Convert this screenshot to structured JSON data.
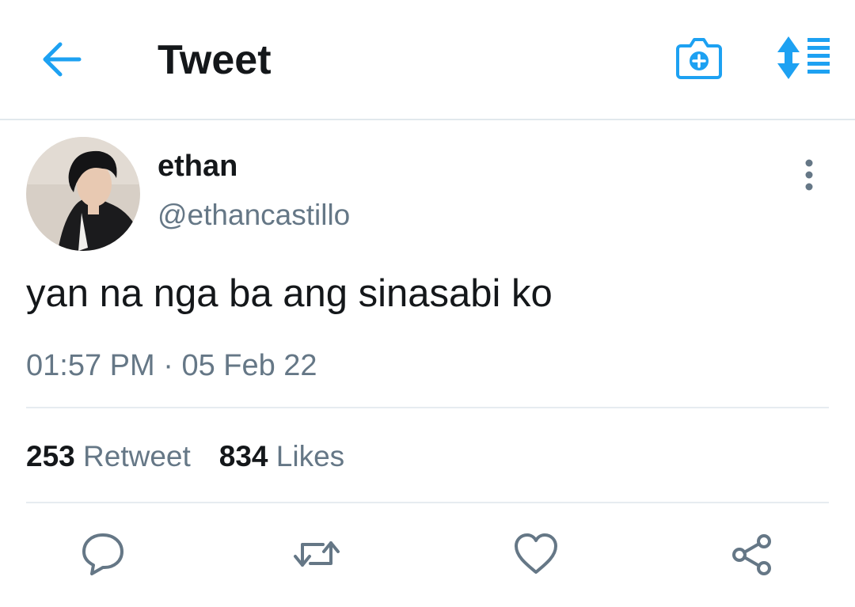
{
  "header": {
    "title": "Tweet",
    "accent_color": "#1da1f2",
    "icons": [
      "back-arrow-icon",
      "camera-plus-icon",
      "sort-list-icon"
    ]
  },
  "tweet": {
    "display_name": "ethan",
    "handle": "@ethancastillo",
    "text": "yan na nga ba ang sinasabi ko",
    "time": "01:57 PM",
    "separator": "·",
    "date": "05 Feb 22"
  },
  "stats": {
    "retweet_count": "253",
    "retweet_label": "Retweet",
    "like_count": "834",
    "like_label": "Likes"
  },
  "actions": {
    "icons": [
      "reply-icon",
      "retweet-icon",
      "like-heart-icon",
      "share-icon"
    ],
    "icon_color": "#657786"
  }
}
